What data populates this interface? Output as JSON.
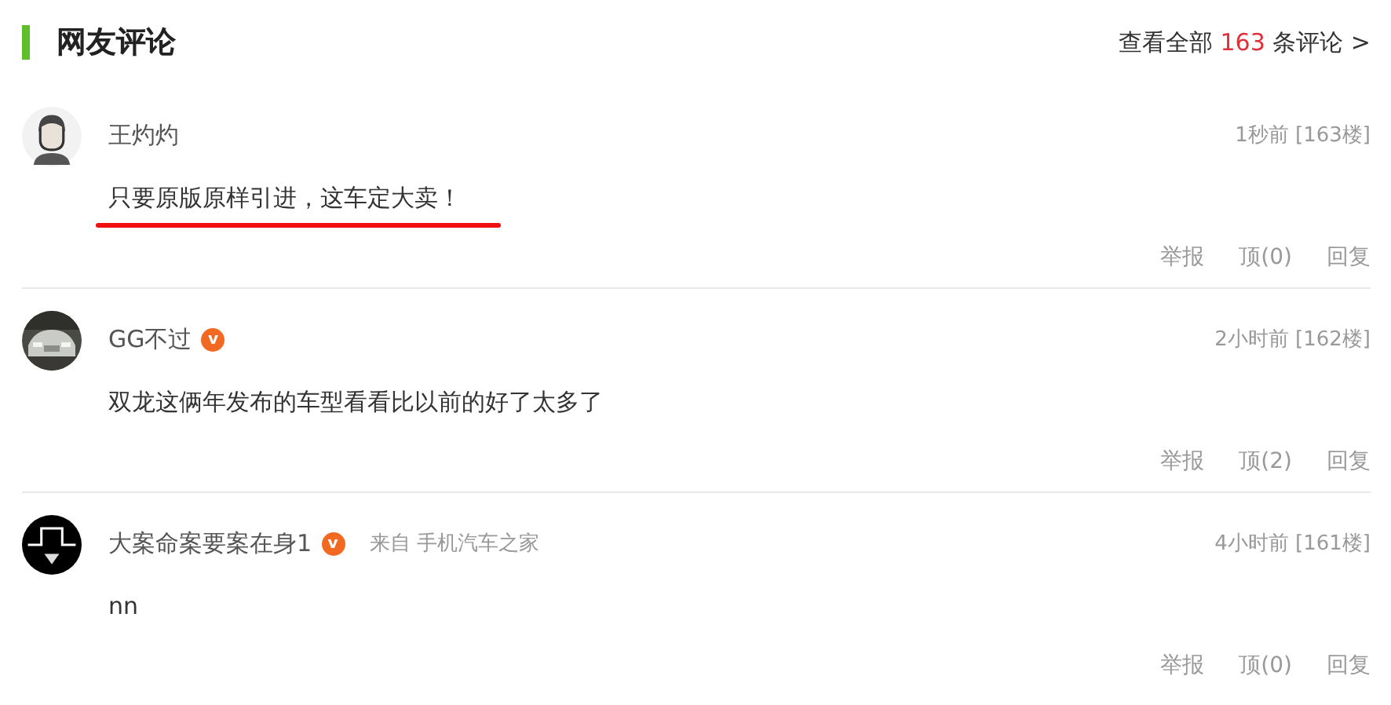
{
  "section": {
    "title": "网友评论",
    "view_all": {
      "prefix": "查看全部",
      "count": "163",
      "suffix": "条评论 >"
    }
  },
  "comments": [
    {
      "kind": "figure",
      "user": "王灼灼",
      "verified": false,
      "content": "只要原版原样引进，这车定大卖！",
      "underlined": true,
      "time": "1秒前 [163楼]",
      "actions": [
        "举报",
        "顶(0)",
        "回复"
      ]
    },
    {
      "kind": "picture",
      "user": "GG不过",
      "verified": true,
      "badge": "v",
      "content": "双龙这俩年发布的车型看看比以前的好了太多了",
      "underlined": false,
      "time": "2小时前 [162楼]",
      "actions": [
        "举报",
        "顶(2)",
        "回复"
      ]
    },
    {
      "kind": "hat",
      "user": "大案命案要案在身1",
      "verified": true,
      "badge": "v",
      "source": "来自 手机汽车之家",
      "content": "nn",
      "underlined": false,
      "time": "4小时前 [161楼]",
      "actions": [
        "举报",
        "顶(0)",
        "回复"
      ]
    }
  ]
}
